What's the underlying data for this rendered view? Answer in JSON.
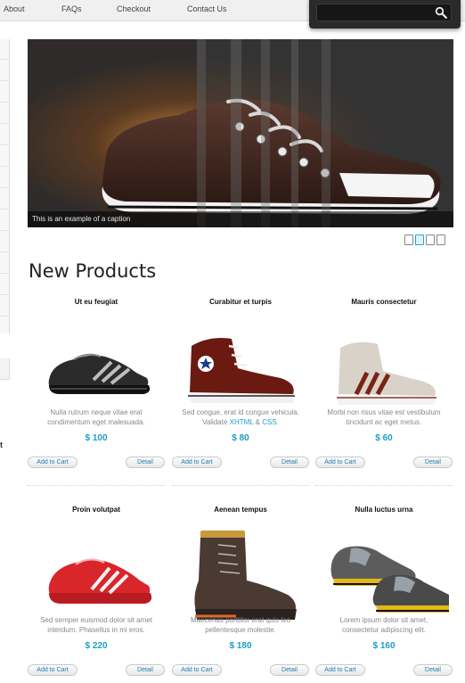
{
  "nav": {
    "items": [
      "About",
      "FAQs",
      "Checkout",
      "Contact Us"
    ],
    "search_placeholder": ""
  },
  "slider": {
    "caption": "This is an example of a caption",
    "pager_count": 4,
    "active_index": 1
  },
  "section": {
    "title": "New Products"
  },
  "sidebar": {
    "fragment_text": "t"
  },
  "buttons": {
    "add_to_cart": "Add to Cart",
    "detail": "Detail"
  },
  "products": [
    {
      "title": "Ut eu feugiat",
      "desc_before": "Nulla rutrum neque vitae erat condimentum eget malesuada.",
      "desc_hl1": "",
      "desc_mid": "",
      "desc_hl2": "",
      "desc_after": "",
      "price": "$ 100",
      "shoe": "black-adidas"
    },
    {
      "title": "Curabitur et turpis",
      "desc_before": "Sed congue, erat id congue vehicula. Validate ",
      "desc_hl1": "XHTML",
      "desc_mid": " & ",
      "desc_hl2": "CSS",
      "desc_after": ".",
      "price": "$ 80",
      "shoe": "maroon-hightop"
    },
    {
      "title": "Mauris consectetur",
      "desc_before": "Morbi non risus vitae est vestibulum tincidunt ac eget metus.",
      "desc_hl1": "",
      "desc_mid": "",
      "desc_hl2": "",
      "desc_after": "",
      "price": "$ 60",
      "shoe": "grey-hightop"
    },
    {
      "title": "Proin volutpat",
      "desc_before": "Sed semper euismod dolor sit amet interdum. Phasellus in mi eros.",
      "desc_hl1": "",
      "desc_mid": "",
      "desc_hl2": "",
      "desc_after": "",
      "price": "$ 220",
      "shoe": "red-adidas"
    },
    {
      "title": "Aenean tempus",
      "desc_before": "Maecenas porttitor erat quis leo pellentesque molestie.",
      "desc_hl1": "",
      "desc_mid": "",
      "desc_hl2": "",
      "desc_after": "",
      "price": "$ 180",
      "shoe": "brown-boot"
    },
    {
      "title": "Nulla luctus urna",
      "desc_before": "Lorem ipsum dolor sit amet, consectetur adipiscing elit.",
      "desc_hl1": "",
      "desc_mid": "",
      "desc_hl2": "",
      "desc_after": "",
      "price": "$ 160",
      "shoe": "black-yellow-sneakers"
    }
  ],
  "colors": {
    "accent": "#1a9ec4",
    "search_bg": "#2a2a2a"
  }
}
